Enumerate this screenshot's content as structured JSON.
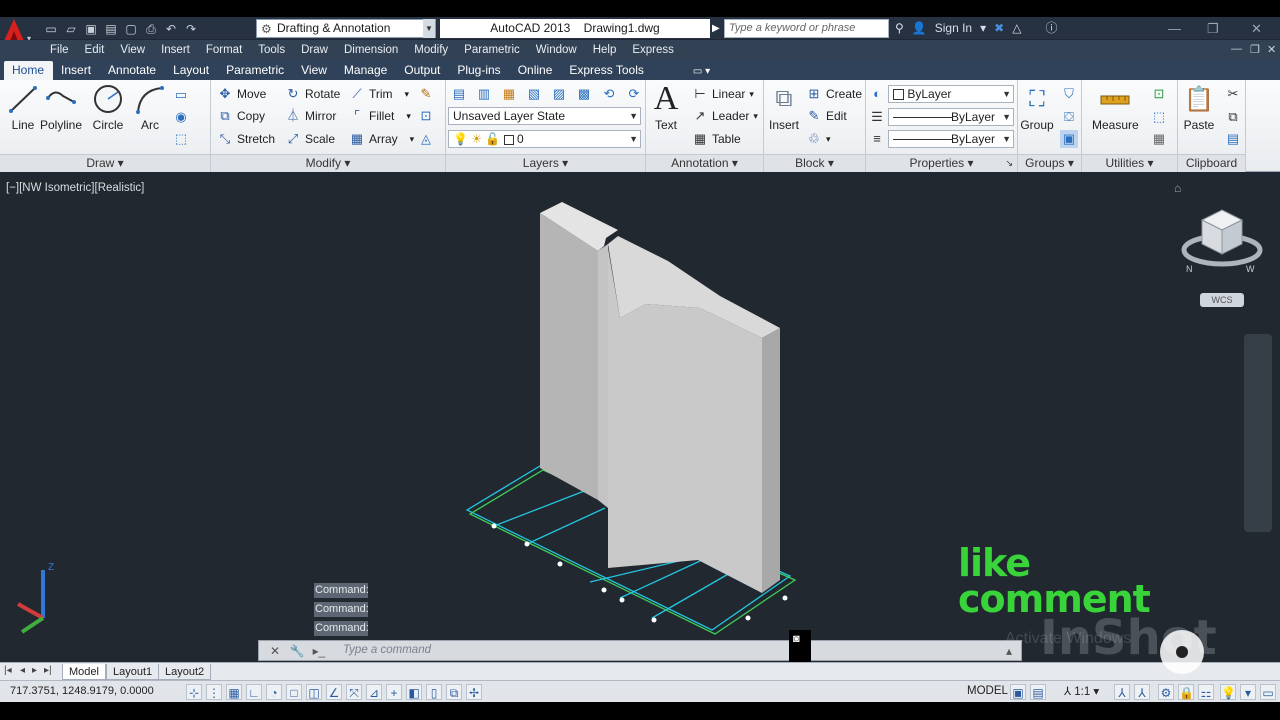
{
  "app": {
    "workspace": "Drafting & Annotation",
    "title": "AutoCAD 2013",
    "drawing": "Drawing1.dwg",
    "search_placeholder": "Type a keyword or phrase",
    "sign_in": "Sign In"
  },
  "menu": [
    "File",
    "Edit",
    "View",
    "Insert",
    "Format",
    "Tools",
    "Draw",
    "Dimension",
    "Modify",
    "Parametric",
    "Window",
    "Help",
    "Express"
  ],
  "tabs": [
    "Home",
    "Insert",
    "Annotate",
    "Layout",
    "Parametric",
    "View",
    "Manage",
    "Output",
    "Plug-ins",
    "Online",
    "Express Tools"
  ],
  "ribbon": {
    "draw": {
      "title": "Draw",
      "line": "Line",
      "polyline": "Polyline",
      "circle": "Circle",
      "arc": "Arc"
    },
    "modify": {
      "title": "Modify",
      "move": "Move",
      "rotate": "Rotate",
      "trim": "Trim",
      "copy": "Copy",
      "mirror": "Mirror",
      "fillet": "Fillet",
      "stretch": "Stretch",
      "scale": "Scale",
      "array": "Array"
    },
    "layers": {
      "title": "Layers",
      "layer_state": "Unsaved Layer State",
      "current_layer": "0"
    },
    "annotation": {
      "title": "Annotation",
      "text": "Text",
      "linear": "Linear",
      "leader": "Leader",
      "table": "Table"
    },
    "block": {
      "title": "Block",
      "insert": "Insert",
      "create": "Create",
      "edit": "Edit"
    },
    "properties": {
      "title": "Properties",
      "color": "ByLayer",
      "linetype": "ByLayer",
      "lineweight": "ByLayer"
    },
    "groups": {
      "title": "Groups",
      "group": "Group"
    },
    "utilities": {
      "title": "Utilities",
      "measure": "Measure"
    },
    "clipboard": {
      "title": "Clipboard",
      "paste": "Paste"
    }
  },
  "viewport": {
    "label": "[−][NW Isometric][Realistic]",
    "wcs": "WCS"
  },
  "command": {
    "history": [
      "Command:",
      "Command:",
      "Command:"
    ],
    "placeholder": "Type a command"
  },
  "layout_tabs": [
    "Model",
    "Layout1",
    "Layout2"
  ],
  "status": {
    "coords": "717.3751, 1248.9179, 0.0000",
    "model": "MODEL",
    "scale": "1:1"
  },
  "overlay": {
    "like_line1": "like",
    "like_line2": "comment",
    "watermark": "InShot",
    "activate": "Activate Windows"
  },
  "colors": {
    "accent": "#2a6fc0",
    "viewport_bg": "#212830",
    "ribbon_tab_bar": "#304259",
    "like_green": "#39d43a",
    "edge_cyan": "#23c6e0",
    "edge_green": "#3ecf5a"
  }
}
